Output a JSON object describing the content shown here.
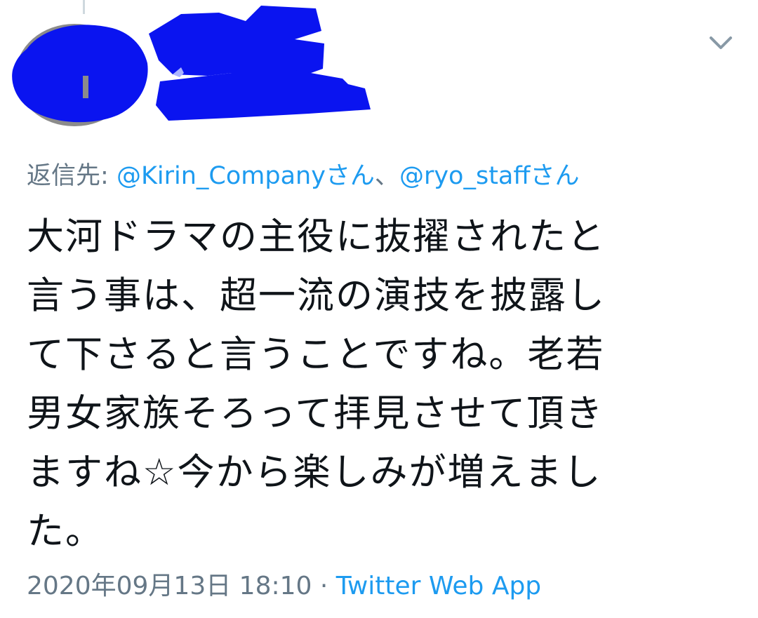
{
  "reply": {
    "prefix": "返信先:",
    "mentions": [
      "@Kirin_Companyさん",
      "@ryo_staffさん"
    ],
    "separator": "、"
  },
  "tweet": {
    "text": "大河ドラマの主役に抜擢されたと\n言う事は、超一流の演技を披露し\nて下さると言うことですね。老若\n男女家族そろって拝見させて頂き\nますね☆今から楽しみが増えまし\nた。"
  },
  "meta": {
    "timestamp": "2020年09月13日 18:10",
    "dot": "·",
    "source": "Twitter Web App"
  },
  "icons": {
    "caret": "chevron-down-icon",
    "avatar": "avatar"
  },
  "colors": {
    "link": "#1d9bf0",
    "secondary_text": "#657786",
    "primary_text": "#0f1419",
    "redaction": "#0a14f0"
  }
}
